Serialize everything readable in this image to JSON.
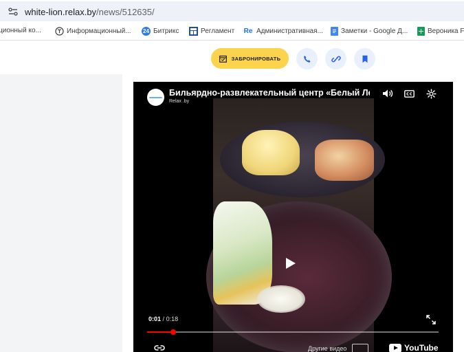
{
  "browser": {
    "url_host": "white-lion.relax.by",
    "url_path": "/news/512635/",
    "bookmarks": [
      {
        "label": "ционный ко...",
        "icon": "none"
      },
      {
        "label": "Информационный...",
        "icon": "circle-t-icon"
      },
      {
        "label": "Битрикс",
        "icon": "bitrix24-icon"
      },
      {
        "label": "Регламент",
        "icon": "table-icon"
      },
      {
        "label": "Административная...",
        "icon": "re-icon"
      },
      {
        "label": "Заметки - Google Д...",
        "icon": "google-docs-icon"
      },
      {
        "label": "Вероника F",
        "icon": "google-sheets-icon"
      }
    ]
  },
  "header": {
    "book_label": "ЗАБРОНИРОВАТЬ",
    "accent": "#fcd34d",
    "round_buttons": [
      "phone-icon",
      "link-icon",
      "bookmark-icon"
    ]
  },
  "video": {
    "title": "Бильярдно-развлекательный центр «Белый Ле",
    "channel": "Relax .by",
    "current_time": "0:01",
    "separator": "/",
    "duration": "0:18",
    "progress": 0.09,
    "more_videos": "Другие видео",
    "youtube_label": "YouTube"
  }
}
